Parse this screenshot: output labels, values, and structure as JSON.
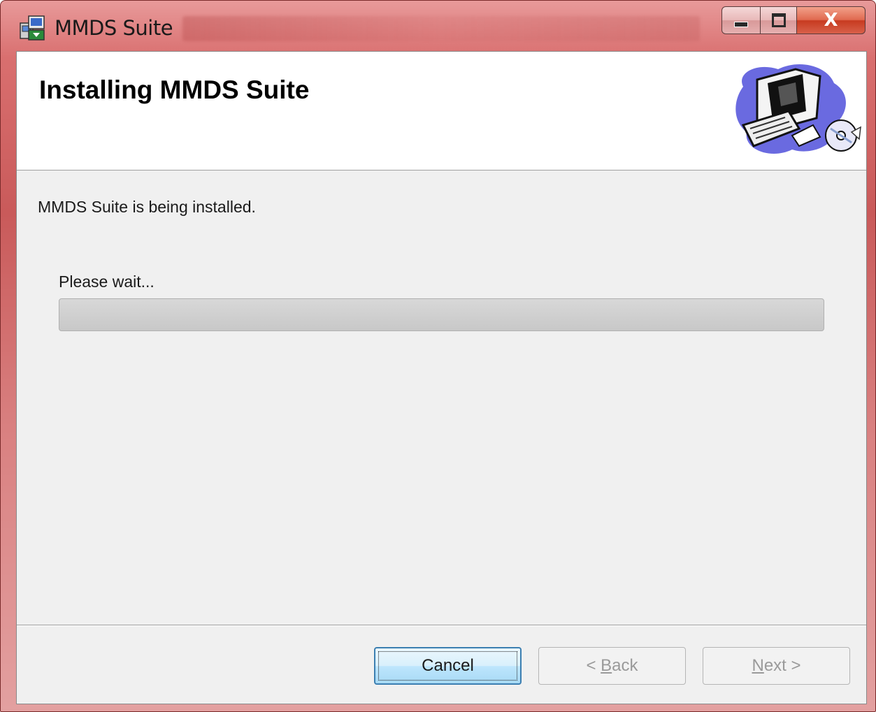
{
  "window": {
    "title": "MMDS Suite",
    "icons": {
      "app": "installer-package-icon",
      "minimize": "minimize-icon",
      "maximize": "maximize-icon",
      "close": "close-icon"
    },
    "close_glyph": "X"
  },
  "banner": {
    "title": "Installing MMDS Suite",
    "art": "computer-with-cd-illustration"
  },
  "body": {
    "status": "MMDS Suite is being installed.",
    "wait_label": "Please wait...",
    "progress_fraction": 0
  },
  "buttons": {
    "cancel": "Cancel",
    "back_arrow": "<",
    "back_accel": "B",
    "back_rest": "ack",
    "next_accel": "N",
    "next_rest": "ext",
    "next_arrow": ">"
  },
  "colors": {
    "title_bar": "#d96f6f",
    "close_button": "#c73b20",
    "dialog_bg": "#f0f0f0",
    "banner_bg": "#ffffff",
    "focus_button": "#3c7fb1"
  }
}
